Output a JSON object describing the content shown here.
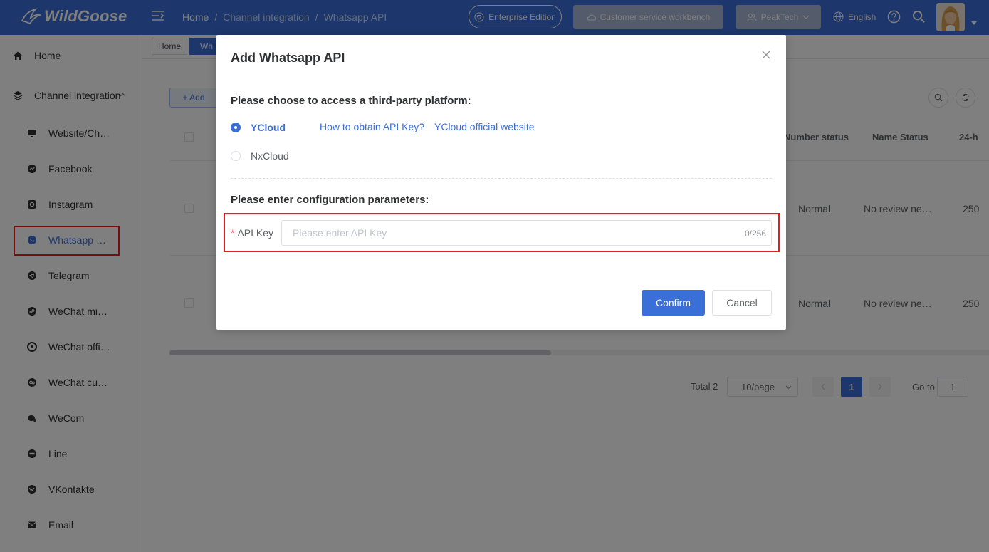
{
  "header": {
    "logo_text": "WildGoose",
    "breadcrumb": [
      "Home",
      "Channel integration",
      "Whatsapp API"
    ],
    "breadcrumb_sep": "/",
    "edition_label": "Enterprise Edition",
    "workbench_label": "Customer service workbench",
    "tenant_label": "PeakTech",
    "language_label": "English",
    "colors": {
      "primary": "#3b6fd8"
    }
  },
  "sidebar": {
    "home": "Home",
    "group": "Channel integration",
    "items": [
      {
        "label": "Website/Ch…",
        "icon": "monitor-icon"
      },
      {
        "label": "Facebook",
        "icon": "messenger-icon"
      },
      {
        "label": "Instagram",
        "icon": "instagram-icon"
      },
      {
        "label": "Whatsapp …",
        "icon": "whatsapp-icon",
        "active": true
      },
      {
        "label": "Telegram",
        "icon": "telegram-icon"
      },
      {
        "label": "WeChat mi…",
        "icon": "wechat-mini-icon"
      },
      {
        "label": "WeChat offi…",
        "icon": "wechat-official-icon"
      },
      {
        "label": "WeChat cu…",
        "icon": "wechat-cs-icon"
      },
      {
        "label": "WeCom",
        "icon": "wecom-icon"
      },
      {
        "label": "Line",
        "icon": "line-icon"
      },
      {
        "label": "VKontakte",
        "icon": "vk-icon"
      },
      {
        "label": "Email",
        "icon": "email-icon"
      }
    ]
  },
  "tabs": {
    "home": "Home",
    "active": "Wh"
  },
  "toolbar": {
    "add_label": "+ Add"
  },
  "table": {
    "headers": {
      "number_status": "Number status",
      "name_status": "Name Status",
      "limit": "24-h"
    },
    "rows": [
      {
        "number_status": "Normal",
        "name_status": "No review ne…",
        "limit": "250"
      },
      {
        "number_status": "Normal",
        "name_status": "No review ne…",
        "limit": "250"
      }
    ]
  },
  "pagination": {
    "total": "Total 2",
    "page_size": "10/page",
    "current_page": "1",
    "goto_label": "Go to",
    "goto_value": "1"
  },
  "dialog": {
    "title": "Add Whatsapp API",
    "platform_prompt": "Please choose to access a third-party platform:",
    "options": [
      {
        "label": "YCloud",
        "checked": true
      },
      {
        "label": "NxCloud",
        "checked": false
      }
    ],
    "link_api_key": "How to obtain API Key?",
    "link_official": "YCloud official website",
    "config_prompt": "Please enter configuration parameters:",
    "api_key_label": "API Key",
    "api_key_required_mark": "*",
    "api_key_placeholder": "Please enter API Key",
    "api_key_value": "",
    "api_key_counter": "0/256",
    "confirm_label": "Confirm",
    "cancel_label": "Cancel"
  }
}
